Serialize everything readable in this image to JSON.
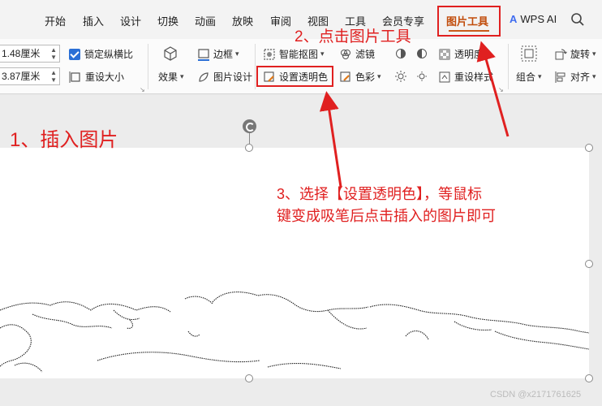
{
  "menu": {
    "items": [
      "开始",
      "插入",
      "设计",
      "切换",
      "动画",
      "放映",
      "审阅",
      "视图",
      "工具",
      "会员专享"
    ],
    "active_tab": "图片工具",
    "wps_ai": "WPS AI"
  },
  "ribbon": {
    "width_value": "1.48厘米",
    "height_value": "3.87厘米",
    "lock_ratio": "锁定纵横比",
    "reset_size": "重设大小",
    "effects": "效果",
    "border": "边框",
    "picture_design": "图片设计",
    "smart_cutout": "智能抠图",
    "set_transparent": "设置透明色",
    "filter": "滤镜",
    "color": "色彩",
    "transparency": "透明度",
    "reset_style": "重设样式",
    "combine": "组合",
    "rotate": "旋转",
    "align": "对齐"
  },
  "annotations": {
    "step1": "1、插入图片",
    "step2": "2、点击图片工具",
    "step3_line1": "3、选择【设置透明色】，等鼠标",
    "step3_line2": "键变成吸笔后点击插入的图片即可"
  },
  "watermark": "CSDN @x2171761625",
  "colors": {
    "accent_red": "#e02020",
    "active_tab": "#c14d0c",
    "checkbox_blue": "#2a6fd6"
  }
}
